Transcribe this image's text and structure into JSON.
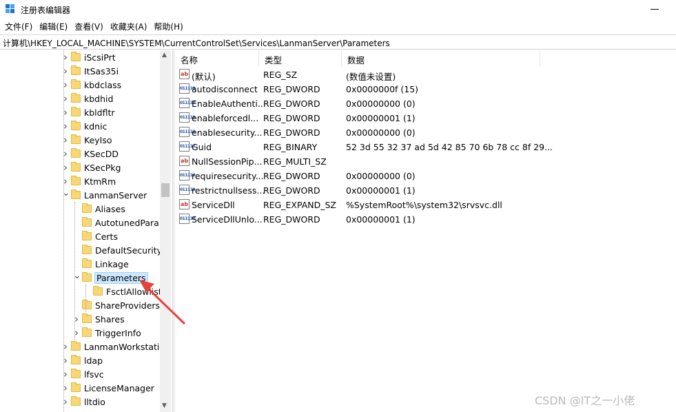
{
  "window": {
    "title": "注册表编辑器"
  },
  "menu": [
    {
      "label": "文件(F)"
    },
    {
      "label": "编辑(E)"
    },
    {
      "label": "查看(V)"
    },
    {
      "label": "收藏夹(A)"
    },
    {
      "label": "帮助(H)"
    }
  ],
  "address": "计算机\\HKEY_LOCAL_MACHINE\\SYSTEM\\CurrentControlSet\\Services\\LanmanServer\\Parameters",
  "tree": [
    {
      "label": "iScsiPrt",
      "level": 0,
      "chevron": "right"
    },
    {
      "label": "ItSas35i",
      "level": 0,
      "chevron": "right"
    },
    {
      "label": "kbdclass",
      "level": 0,
      "chevron": "right"
    },
    {
      "label": "kbdhid",
      "level": 0,
      "chevron": "right"
    },
    {
      "label": "kbldfltr",
      "level": 0,
      "chevron": "right"
    },
    {
      "label": "kdnic",
      "level": 0,
      "chevron": "right"
    },
    {
      "label": "KeyIso",
      "level": 0,
      "chevron": "right"
    },
    {
      "label": "KSecDD",
      "level": 0,
      "chevron": "right"
    },
    {
      "label": "KSecPkg",
      "level": 0,
      "chevron": "right"
    },
    {
      "label": "KtmRm",
      "level": 0,
      "chevron": "right"
    },
    {
      "label": "LanmanServer",
      "level": 0,
      "chevron": "down"
    },
    {
      "label": "Aliases",
      "level": 1,
      "chevron": "none"
    },
    {
      "label": "AutotunedParam",
      "level": 1,
      "chevron": "none"
    },
    {
      "label": "Certs",
      "level": 1,
      "chevron": "none"
    },
    {
      "label": "DefaultSecurity",
      "level": 1,
      "chevron": "none"
    },
    {
      "label": "Linkage",
      "level": 1,
      "chevron": "none"
    },
    {
      "label": "Parameters",
      "level": 1,
      "chevron": "down",
      "selected": true
    },
    {
      "label": "FsctlAllowlist",
      "level": 2,
      "chevron": "none"
    },
    {
      "label": "ShareProviders",
      "level": 1,
      "chevron": "none"
    },
    {
      "label": "Shares",
      "level": 1,
      "chevron": "right"
    },
    {
      "label": "TriggerInfo",
      "level": 1,
      "chevron": "right"
    },
    {
      "label": "LanmanWorkstatio",
      "level": 0,
      "chevron": "right"
    },
    {
      "label": "ldap",
      "level": 0,
      "chevron": "right"
    },
    {
      "label": "lfsvc",
      "level": 0,
      "chevron": "right"
    },
    {
      "label": "LicenseManager",
      "level": 0,
      "chevron": "right"
    },
    {
      "label": "lltdio",
      "level": 0,
      "chevron": "right"
    }
  ],
  "columns": {
    "name": "名称",
    "type": "类型",
    "data": "数据"
  },
  "values": [
    {
      "icon": "ab",
      "name": "(默认)",
      "type": "REG_SZ",
      "data": "(数值未设置)"
    },
    {
      "icon": "bin",
      "name": "autodisconnect",
      "type": "REG_DWORD",
      "data": "0x0000000f (15)"
    },
    {
      "icon": "bin",
      "name": "EnableAuthenti...",
      "type": "REG_DWORD",
      "data": "0x00000000 (0)"
    },
    {
      "icon": "bin",
      "name": "enableforcedl...",
      "type": "REG_DWORD",
      "data": "0x00000001 (1)"
    },
    {
      "icon": "bin",
      "name": "enablesecurity...",
      "type": "REG_DWORD",
      "data": "0x00000000 (0)"
    },
    {
      "icon": "bin",
      "name": "Guid",
      "type": "REG_BINARY",
      "data": "52 3d 55 32 37 ad 5d 42 85 70 6b 78 cc 8f 29..."
    },
    {
      "icon": "ab",
      "name": "NullSessionPip...",
      "type": "REG_MULTI_SZ",
      "data": ""
    },
    {
      "icon": "bin",
      "name": "requiresecurity...",
      "type": "REG_DWORD",
      "data": "0x00000000 (0)"
    },
    {
      "icon": "bin",
      "name": "restrictnullsess...",
      "type": "REG_DWORD",
      "data": "0x00000001 (1)"
    },
    {
      "icon": "ab",
      "name": "ServiceDll",
      "type": "REG_EXPAND_SZ",
      "data": "%SystemRoot%\\system32\\srvsvc.dll"
    },
    {
      "icon": "bin",
      "name": "ServiceDllUnlo...",
      "type": "REG_DWORD",
      "data": "0x00000001 (1)"
    }
  ],
  "watermark": "CSDN @IT之一小佬",
  "colors": {
    "selection": "#cce8ff",
    "folder": "#f8d775",
    "arrow": "#e8413a"
  }
}
